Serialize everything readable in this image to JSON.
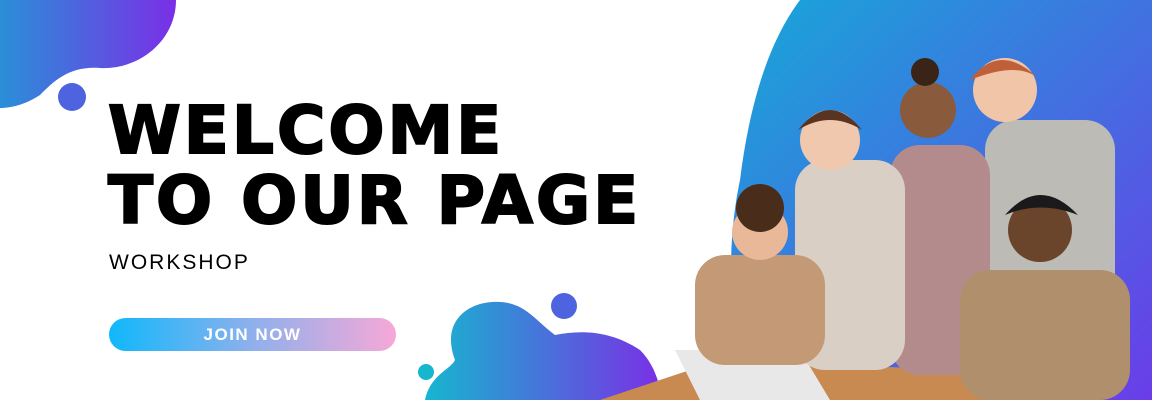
{
  "headline": {
    "line1": "WELCOME",
    "line2": "TO OUR PAGE"
  },
  "subtitle": "WORKSHOP",
  "cta": {
    "label": "JOIN NOW"
  },
  "colors": {
    "blob_start": "#16b3d6",
    "blob_end": "#7a2fe6",
    "button_start": "#0fb8fb",
    "button_end": "#f6a8d7"
  },
  "image": {
    "icon": "people-group-photo"
  }
}
